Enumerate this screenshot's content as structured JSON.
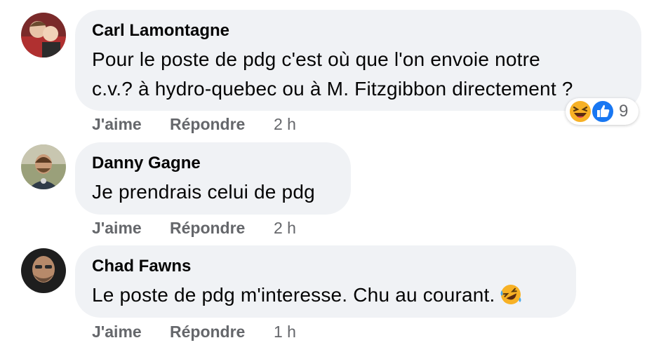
{
  "comments": [
    {
      "author": "Carl Lamontagne",
      "text_line1": "Pour le poste de pdg c'est où que l'on envoie notre",
      "text_line2": "c.v.? à hydro-quebec ou à M. Fitzgibbon directement ?",
      "like_label": "J'aime",
      "reply_label": "Répondre",
      "time": "2 h",
      "reactions": {
        "icons": [
          "haha-emoji",
          "like-thumb"
        ],
        "count": "9"
      }
    },
    {
      "author": "Danny Gagne",
      "text": "Je prendrais celui de pdg",
      "like_label": "J'aime",
      "reply_label": "Répondre",
      "time": "2 h"
    },
    {
      "author": "Chad Fawns",
      "text": "Le poste de pdg m'interesse. Chu au courant.",
      "emoji": "rolling-laughing-emoji",
      "like_label": "J'aime",
      "reply_label": "Répondre",
      "time": "1 h"
    }
  ],
  "colors": {
    "bubble": "#f0f2f5",
    "meta": "#65676b",
    "like_blue": "#1877f2",
    "haha_yellow": "#f7b125"
  }
}
